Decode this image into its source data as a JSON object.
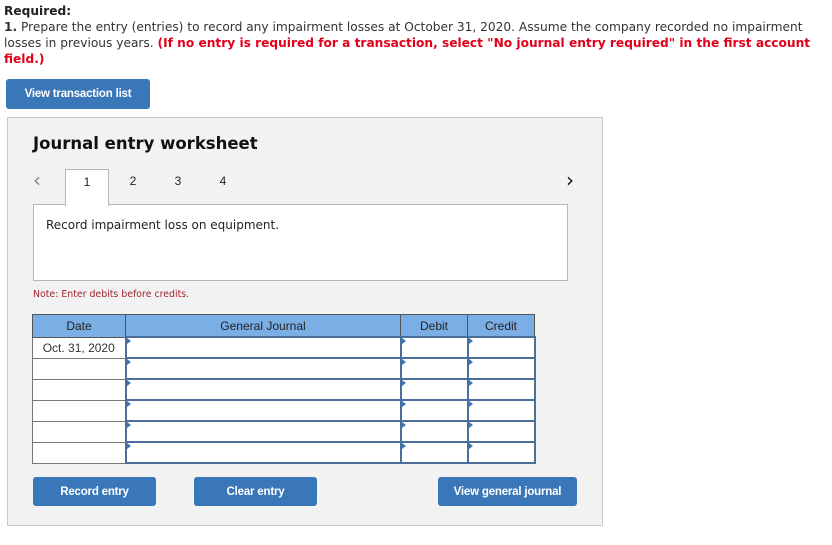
{
  "required": {
    "title": "Required:",
    "number": "1.",
    "instruction": " Prepare the entry (entries) to record any impairment losses at October 31, 2020. Assume the company recorded no impairment losses in previous years. ",
    "red_note": "(If no entry is required for a transaction, select \"No journal entry required\" in the first account field.)"
  },
  "buttons": {
    "view_transaction_list": "View transaction list",
    "record_entry": "Record entry",
    "clear_entry": "Clear entry",
    "view_general_journal": "View general journal"
  },
  "worksheet": {
    "title": "Journal entry worksheet",
    "nav": {
      "prev_icon": "chevron-left-icon",
      "prev_glyph": "‹",
      "next_icon": "chevron-right-icon",
      "next_glyph": "›"
    },
    "tabs": [
      {
        "label": "1",
        "active": true
      },
      {
        "label": "2",
        "active": false
      },
      {
        "label": "3",
        "active": false
      },
      {
        "label": "4",
        "active": false
      }
    ],
    "description": "Record impairment loss on equipment.",
    "note": "Note: Enter debits before credits."
  },
  "journal": {
    "headers": {
      "date": "Date",
      "account": "General Journal",
      "debit": "Debit",
      "credit": "Credit"
    },
    "rows": [
      {
        "date": "Oct. 31, 2020",
        "account": "",
        "debit": "",
        "credit": ""
      },
      {
        "date": "",
        "account": "",
        "debit": "",
        "credit": ""
      },
      {
        "date": "",
        "account": "",
        "debit": "",
        "credit": ""
      },
      {
        "date": "",
        "account": "",
        "debit": "",
        "credit": ""
      },
      {
        "date": "",
        "account": "",
        "debit": "",
        "credit": ""
      },
      {
        "date": "",
        "account": "",
        "debit": "",
        "credit": ""
      }
    ]
  },
  "colors": {
    "button_blue": "#3a77b8",
    "header_blue": "#7aaee5",
    "required_red": "#e2001a",
    "note_red": "#a1262b",
    "panel_bg": "#f2f2f2"
  }
}
